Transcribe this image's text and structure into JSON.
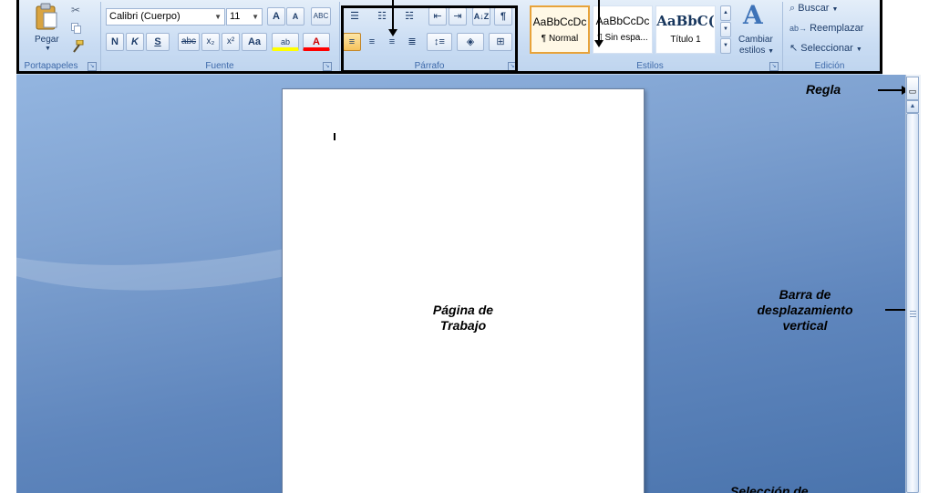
{
  "ribbon": {
    "clipboard": {
      "paste_label": "Pegar",
      "group_label": "Portapapeles",
      "icons": [
        "paste-icon",
        "cut-icon",
        "copy-icon",
        "format-painter-icon"
      ]
    },
    "font": {
      "font_name": "Calibri (Cuerpo)",
      "font_size": "11",
      "grow_label": "A",
      "shrink_label": "A",
      "clear_format_label": "ABC",
      "bold_label": "N",
      "italic_label": "K",
      "underline_label": "S",
      "strike_label": "abc",
      "subscript_label": "x₂",
      "superscript_label": "x²",
      "case_label": "Aa",
      "highlight_label": "ab",
      "color_label": "A",
      "group_label": "Fuente"
    },
    "paragraph": {
      "group_label": "Párrafo",
      "sort_label": "A↓Z",
      "show_marks_label": "¶"
    },
    "styles": {
      "group_label": "Estilos",
      "items": [
        {
          "sample": "AaBbCcDc",
          "name": "¶ Normal",
          "selected": true
        },
        {
          "sample": "AaBbCcDc",
          "name": "¶ Sin espa...",
          "selected": false
        },
        {
          "sample": "AaBbC(",
          "name": "Título 1",
          "selected": false
        }
      ],
      "change_styles_label_1": "Cambiar",
      "change_styles_label_2": "estilos",
      "change_styles_icon": "A"
    },
    "editing": {
      "group_label": "Edición",
      "find_label": "Buscar",
      "replace_label": "Reemplazar",
      "select_label": "Seleccionar"
    }
  },
  "workspace": {
    "page_label_line1": "Página de",
    "page_label_line2": "Trabajo",
    "annotations": {
      "ruler": "Regla",
      "vscroll_line1": "Barra de",
      "vscroll_line2": "desplazamiento",
      "vscroll_line3": "vertical",
      "selection_partial": "Selección de"
    }
  },
  "colors": {
    "ribbon_top": "#e4eef9",
    "ribbon_bottom": "#bed4ee",
    "group_label": "#3e6aaa",
    "workspace_light": "#93b5e0",
    "workspace_dark": "#4a74ad",
    "active_style_border": "#e8a33a",
    "highlight_yellow": "#ffff00",
    "font_color_red": "#ff0000"
  }
}
